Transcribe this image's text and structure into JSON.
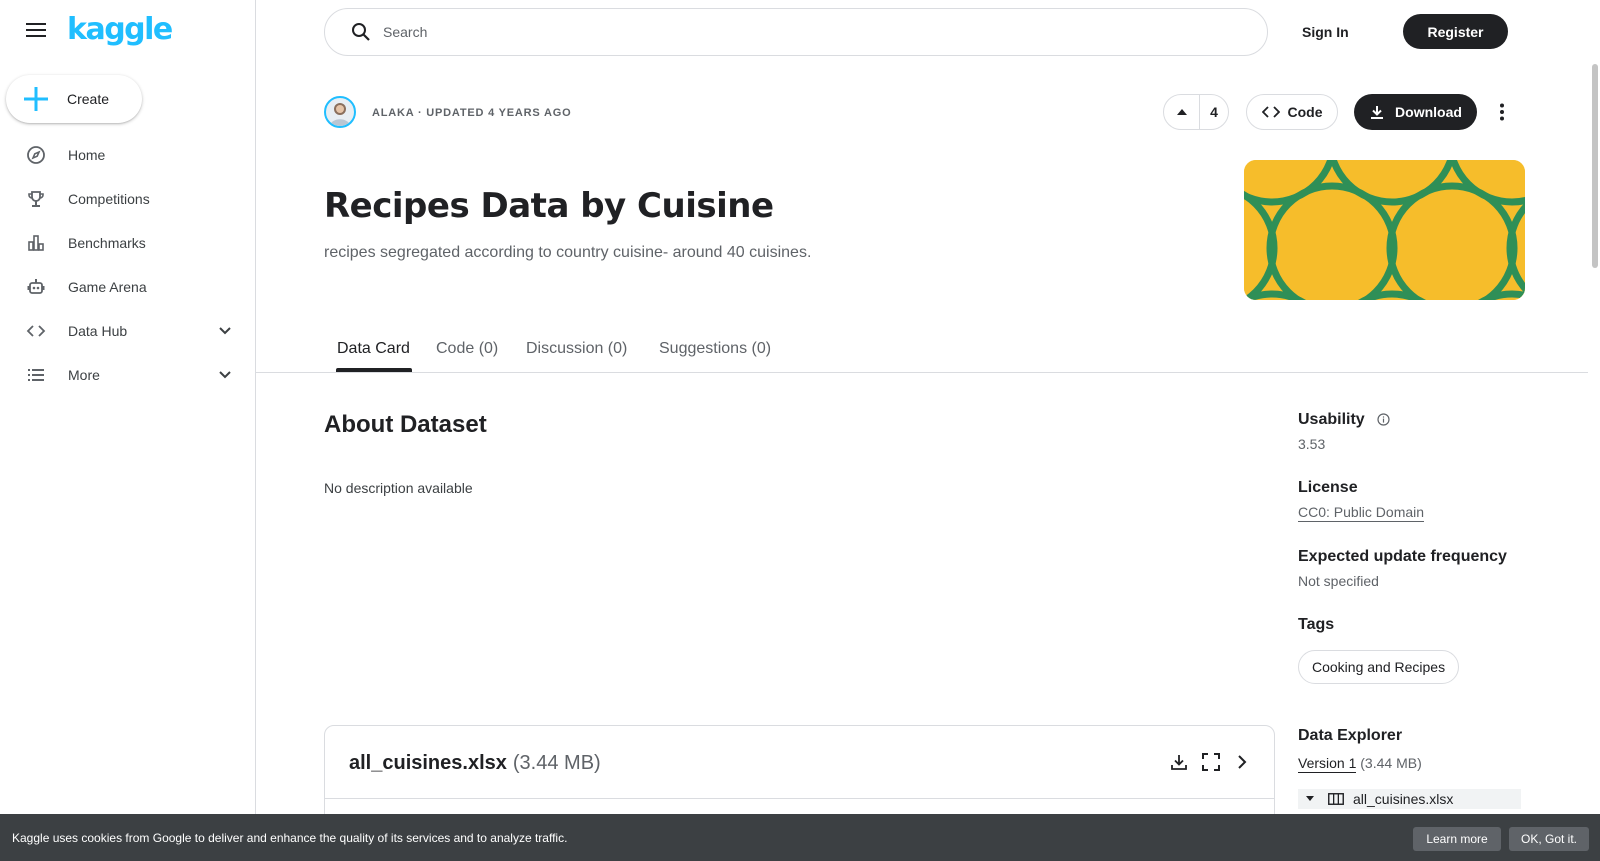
{
  "brand": {
    "logo_text": "kaggle",
    "accent": "#20beff"
  },
  "sidebar": {
    "create_label": "Create",
    "items": [
      {
        "label": "Home",
        "icon": "compass-icon"
      },
      {
        "label": "Competitions",
        "icon": "trophy-icon"
      },
      {
        "label": "Benchmarks",
        "icon": "bar-chart-icon"
      },
      {
        "label": "Game Arena",
        "icon": "robot-icon"
      },
      {
        "label": "Data Hub",
        "icon": "code-brackets-icon",
        "expandable": true
      },
      {
        "label": "More",
        "icon": "list-icon",
        "expandable": true
      }
    ]
  },
  "header": {
    "search_placeholder": "Search",
    "sign_in": "Sign In",
    "register": "Register"
  },
  "dataset": {
    "meta": "ALAKA · UPDATED 4 YEARS AGO",
    "upvotes": "4",
    "code_label": "Code",
    "download_label": "Download",
    "title": "Recipes Data by Cuisine",
    "subtitle": "recipes segregated according to country cuisine- around 40 cuisines.",
    "cover_colors": {
      "background": "#f6bd2b",
      "pattern": "#2f8f57"
    }
  },
  "tabs": [
    {
      "label": "Data Card",
      "active": true
    },
    {
      "label": "Code (0)",
      "active": false
    },
    {
      "label": "Discussion (0)",
      "active": false
    },
    {
      "label": "Suggestions (0)",
      "active": false
    }
  ],
  "about": {
    "heading": "About Dataset",
    "description": "No description available"
  },
  "side": {
    "usability_label": "Usability",
    "usability_value": "3.53",
    "license_label": "License",
    "license_value": "CC0: Public Domain",
    "frequency_label": "Expected update frequency",
    "frequency_value": "Not specified",
    "tags_label": "Tags",
    "tags": [
      "Cooking and Recipes"
    ],
    "explorer_label": "Data Explorer",
    "version_link": "Version 1",
    "version_size": "(3.44 MB)",
    "explorer_file": "all_cuisines.xlsx"
  },
  "file_card": {
    "name": "all_cuisines.xlsx",
    "size": "(3.44 MB)"
  },
  "cookie": {
    "text": "Kaggle uses cookies from Google to deliver and enhance the quality of its services and to analyze traffic.",
    "learn_more": "Learn more",
    "ok": "OK, Got it."
  }
}
